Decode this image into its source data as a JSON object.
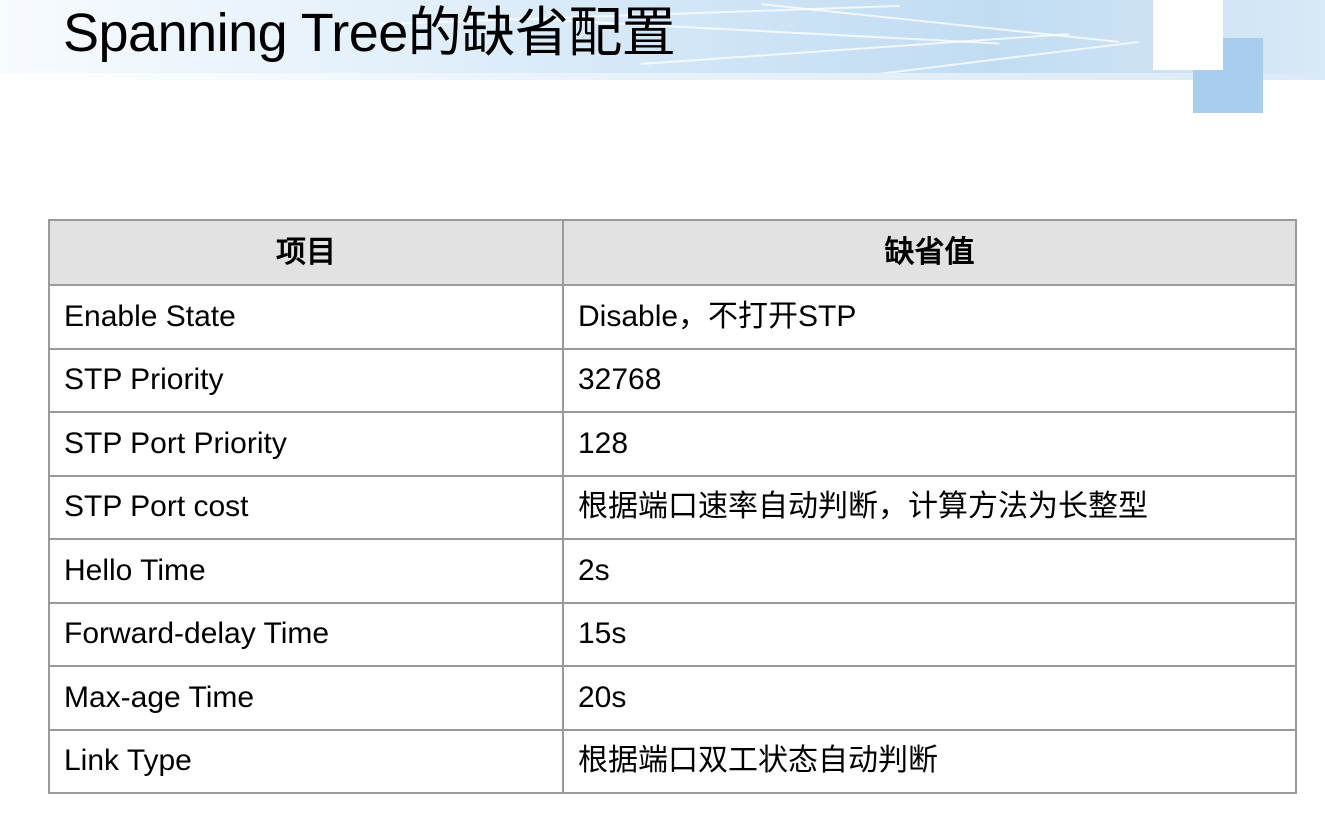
{
  "slide": {
    "title": "Spanning Tree的缺省配置"
  },
  "table": {
    "headers": [
      "项目",
      "缺省值"
    ],
    "rows": [
      {
        "item": "Enable State",
        "value": "Disable，不打开STP"
      },
      {
        "item": "STP Priority",
        "value": "32768"
      },
      {
        "item": "STP Port Priority",
        "value": "128"
      },
      {
        "item": "STP Port cost",
        "value": "根据端口速率自动判断，计算方法为长整型"
      },
      {
        "item": "Hello Time",
        "value": "2s"
      },
      {
        "item": "Forward-delay Time",
        "value": "15s"
      },
      {
        "item": "Max-age Time",
        "value": "20s"
      },
      {
        "item": "Link Type",
        "value": "根据端口双工状态自动判断"
      }
    ]
  },
  "colors": {
    "header_fill": "#e2e2e2",
    "grid_line": "#9a9a9a",
    "banner_accent": "#a9cdee"
  }
}
